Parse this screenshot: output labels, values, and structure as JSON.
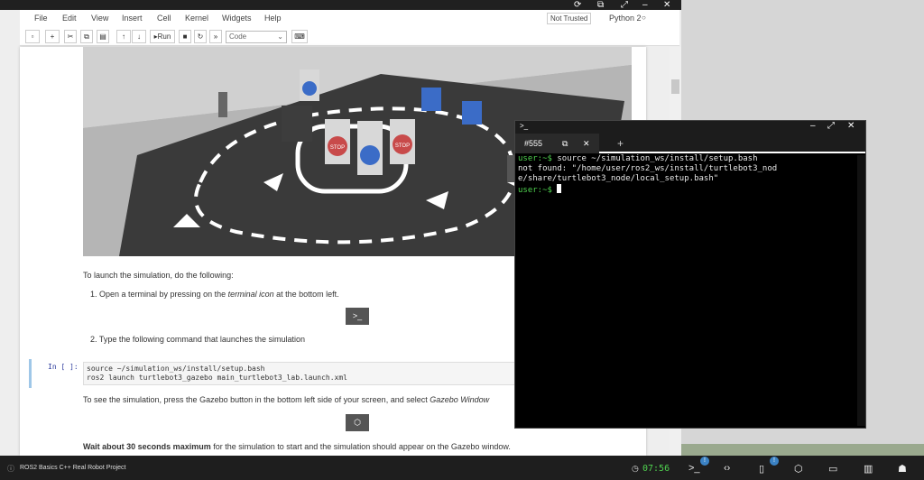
{
  "jupyter": {
    "menu": [
      "File",
      "Edit",
      "View",
      "Insert",
      "Cell",
      "Kernel",
      "Widgets",
      "Help"
    ],
    "trust_badge": "Not Trusted",
    "kernel": "Python 2",
    "run_label": "Run",
    "cell_type": "Code"
  },
  "notebook": {
    "intro": "To launch the simulation, do the following:",
    "step1_pre": "1. Open a terminal by pressing on the ",
    "step1_em": "terminal icon",
    "step1_post": " at the bottom left.",
    "step2": "2. Type the following command that launches the simulation",
    "prompt": "In [ ]:",
    "code_line1": "source ~/simulation_ws/install/setup.bash",
    "code_line2": "ros2 launch turtlebot3_gazebo main_turtlebot3_lab.launch.xml",
    "see_sim_pre": "To see the simulation, press the Gazebo button in the bottom left side of your screen, and select ",
    "see_sim_em": "Gazebo Window",
    "wait_bold": "Wait about 30 seconds maximum",
    "wait_rest": " for the simulation to start and the simulation should appear on the Gazebo window."
  },
  "terminal": {
    "tab_label": "#555",
    "add_tab": "+",
    "line1_prompt": "user:~$",
    "line1_cmd": " source ~/simulation_ws/install/setup.bash",
    "line2": "not found: \"/home/user/ros2_ws/install/turtlebot3_nod",
    "line3": "e/share/turtlebot3_node/local_setup.bash\"",
    "line4_prompt": "user:~$"
  },
  "taskbar": {
    "project_name": "ROS2 Basics C++ Real Robot Project",
    "timer": "07:56",
    "notif_count_1": "!",
    "notif_count_2": "!"
  },
  "sim_signs": {
    "stop": "STOP"
  }
}
